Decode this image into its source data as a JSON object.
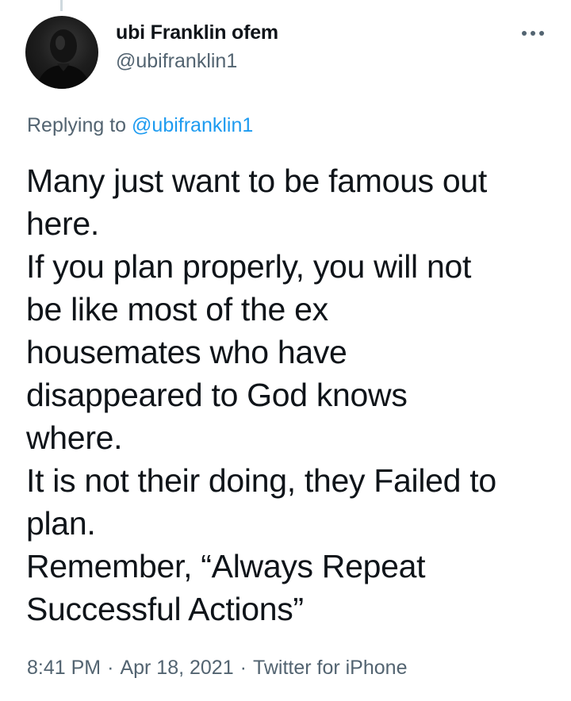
{
  "author": {
    "display_name": "ubi Franklin ofem",
    "handle": "@ubifranklin1"
  },
  "more_icon": "more-horizontal-icon",
  "reply_context": {
    "prefix": "Replying to",
    "mention": "@ubifranklin1"
  },
  "tweet": {
    "lines": [
      "Many just want to be famous out",
      "here.",
      "If you plan properly, you will not",
      "be like most of the ex",
      "housemates who have",
      "disappeared to God knows",
      "where.",
      "It is not their doing, they Failed to",
      "plan.",
      "Remember, “Always Repeat",
      "Successful Actions”"
    ]
  },
  "meta": {
    "time": "8:41 PM",
    "separator": "·",
    "date": "Apr 18, 2021",
    "source": "Twitter for iPhone"
  },
  "colors": {
    "text": "#0f1419",
    "secondary": "#536471",
    "accent": "#1d9bf0"
  }
}
